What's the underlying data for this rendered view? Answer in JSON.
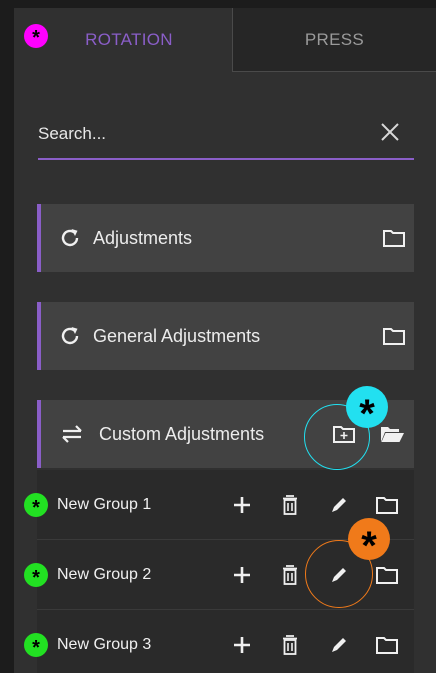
{
  "tabs": [
    {
      "label": "ROTATION",
      "active": true
    },
    {
      "label": "PRESS",
      "active": false
    }
  ],
  "search": {
    "placeholder": "Search..."
  },
  "categories": [
    {
      "label": "Adjustments",
      "icon": "refresh-icon"
    },
    {
      "label": "General Adjustments",
      "icon": "refresh-icon"
    },
    {
      "label": "Custom Adjustments",
      "icon": "swap-arrows-icon",
      "expanded": true
    }
  ],
  "groups": [
    {
      "label": "New Group 1"
    },
    {
      "label": "New Group 2"
    },
    {
      "label": "New Group 3"
    }
  ],
  "annotations": {
    "marker_symbol": "*",
    "colors": {
      "magenta": "#ff00ff",
      "cyan": "#22e0f0",
      "orange": "#f07a1a",
      "green": "#22e022"
    }
  },
  "colors": {
    "accent": "#8a5ec8",
    "panel": "#303030",
    "category_bg": "#424242",
    "group_bg": "#2a2a2a"
  }
}
